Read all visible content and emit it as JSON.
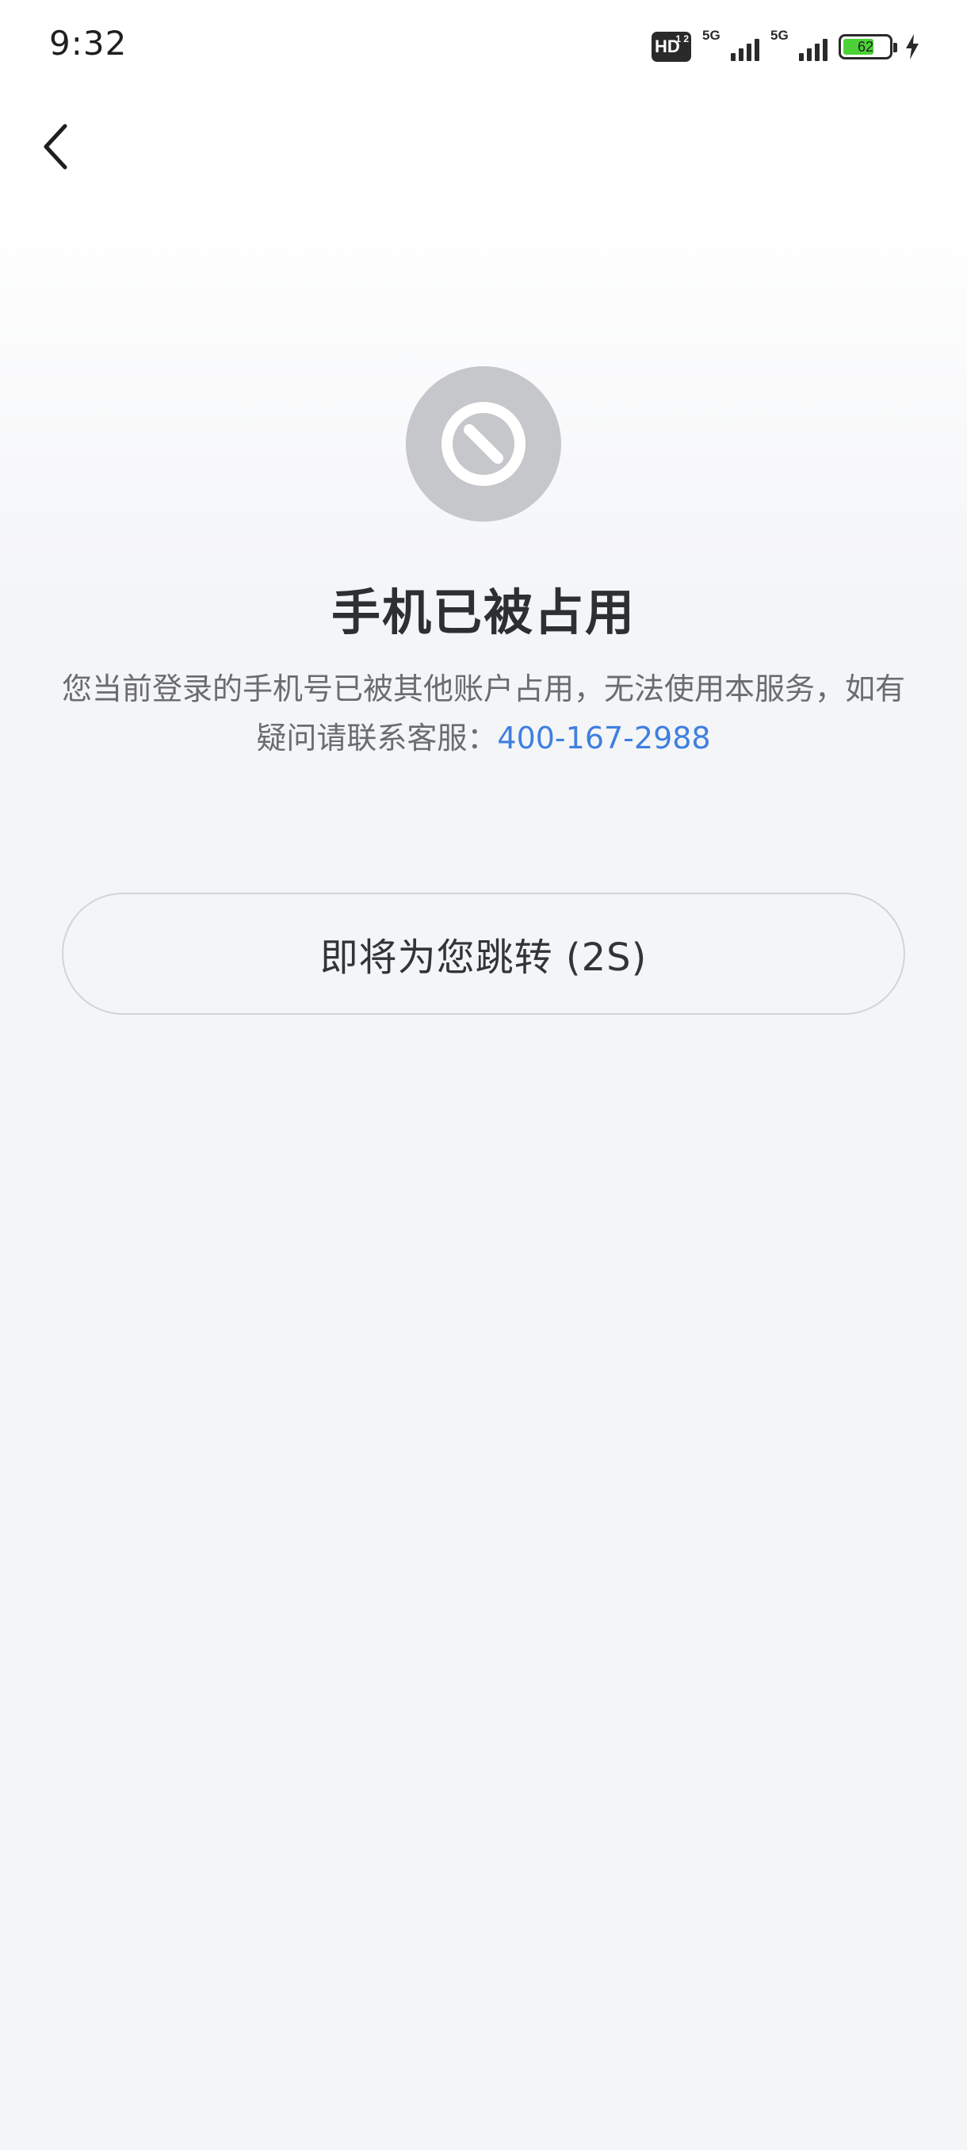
{
  "status_bar": {
    "time": "9:32",
    "hd_label": "HD",
    "hd_sub": "1 2",
    "signal_1_label": "5G",
    "signal_2_label": "5G",
    "battery_level": "62"
  },
  "icons": {
    "back": "chevron-left-icon",
    "status": "blocked-icon"
  },
  "main": {
    "title": "手机已被占用",
    "description": "您当前登录的手机号已被其他账户占用，无法使用本服务，如有疑问请联系客服：",
    "phone": "400-167-2988",
    "redirect_button_label": "即将为您跳转 (2S)"
  },
  "colors": {
    "accent_link": "#3f7fe0",
    "icon_circle": "#c6c7cb",
    "battery_fill": "#4cd137"
  }
}
